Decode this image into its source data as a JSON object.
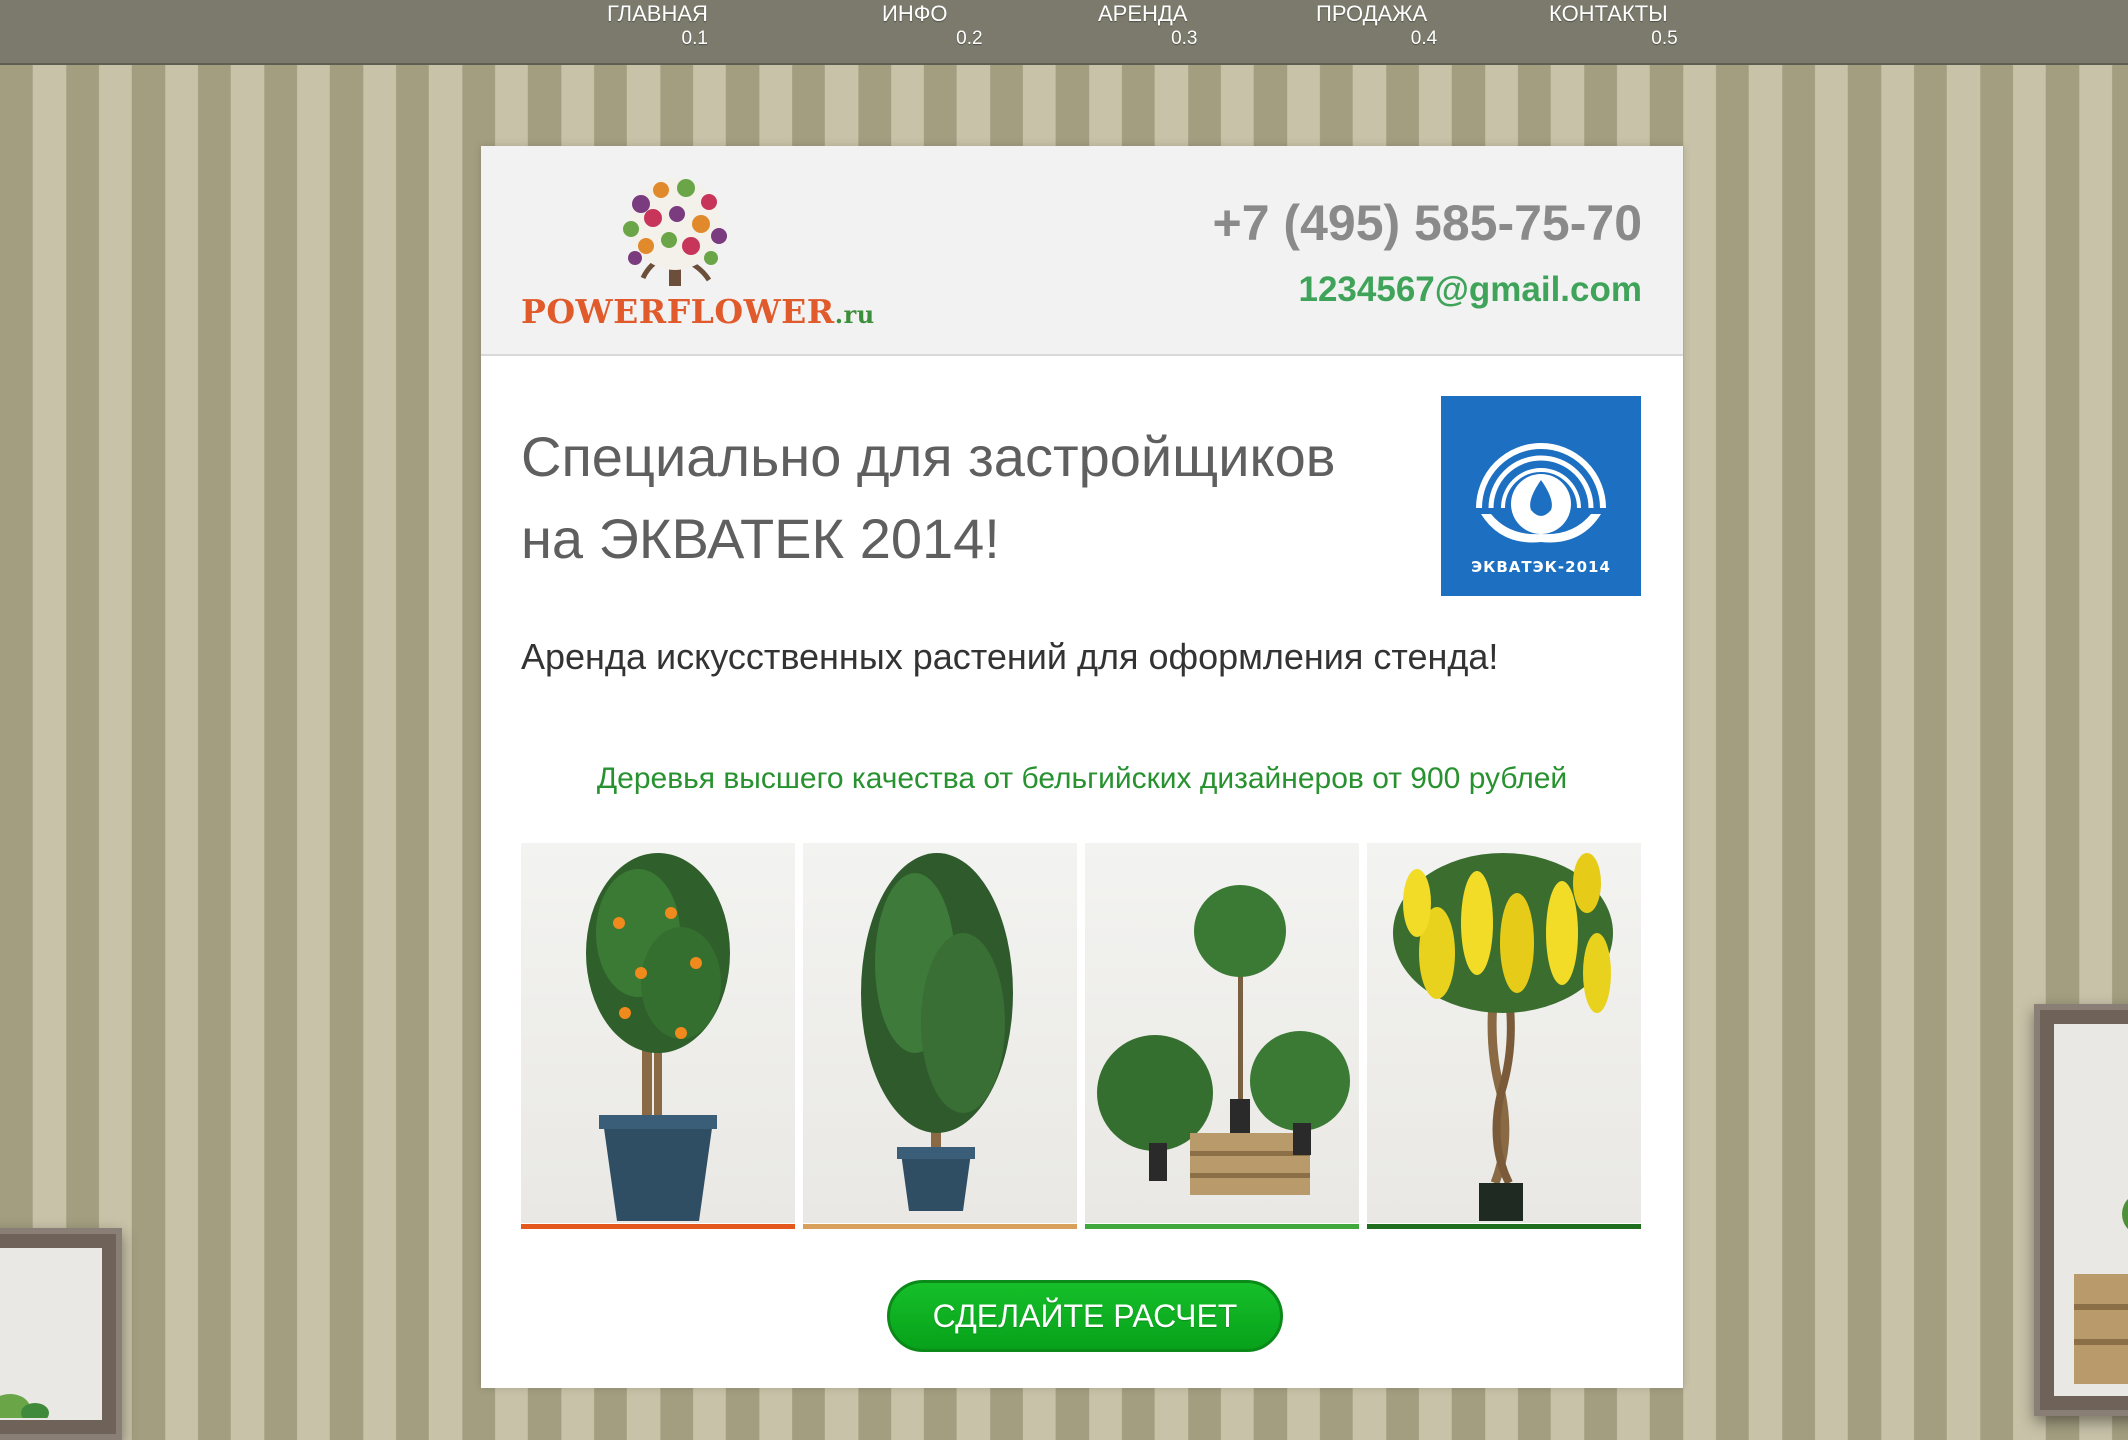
{
  "nav": {
    "items": [
      {
        "label": "ГЛАВНАЯ",
        "num": "0.1"
      },
      {
        "label": "ИНФО",
        "num": "0.2"
      },
      {
        "label": "АРЕНДА",
        "num": "0.3"
      },
      {
        "label": "ПРОДАЖА",
        "num": "0.4"
      },
      {
        "label": "КОНТАКТЫ",
        "num": "0.5"
      }
    ]
  },
  "header": {
    "logo_text": "POWERFLOWER.ru",
    "phone": "+7 (495) 585-75-70",
    "email": "1234567@gmail.com"
  },
  "main": {
    "headline_line1": "Специально для застройщиков",
    "headline_line2": "на ЭКВАТЕК 2014!",
    "badge_text": "ЭКВАТЭК-2014",
    "subline": "Аренда искусственных растений для оформления стенда!",
    "offer": "Деревья высшего качества от бельгийских дизайнеров от 900 рублей",
    "cta_label": "СДЕЛАЙТЕ РАСЧЕТ"
  },
  "gallery": {
    "items": [
      {
        "name": "orange-tree-image",
        "bar_color": "#e4571d"
      },
      {
        "name": "ficus-tree-image",
        "bar_color": "#d9a05b"
      },
      {
        "name": "boxwood-topiary-image",
        "bar_color": "#41a83e"
      },
      {
        "name": "yellow-wisteria-image",
        "bar_color": "#1e6e1e"
      }
    ]
  },
  "colors": {
    "nav_bg": "#7b7a6c",
    "stripe_dark": "#a39e80",
    "stripe_light": "#c8c2a8",
    "accent_green": "#3fa45a",
    "cta_green": "#07a21a",
    "badge_blue": "#1d6fc1"
  }
}
